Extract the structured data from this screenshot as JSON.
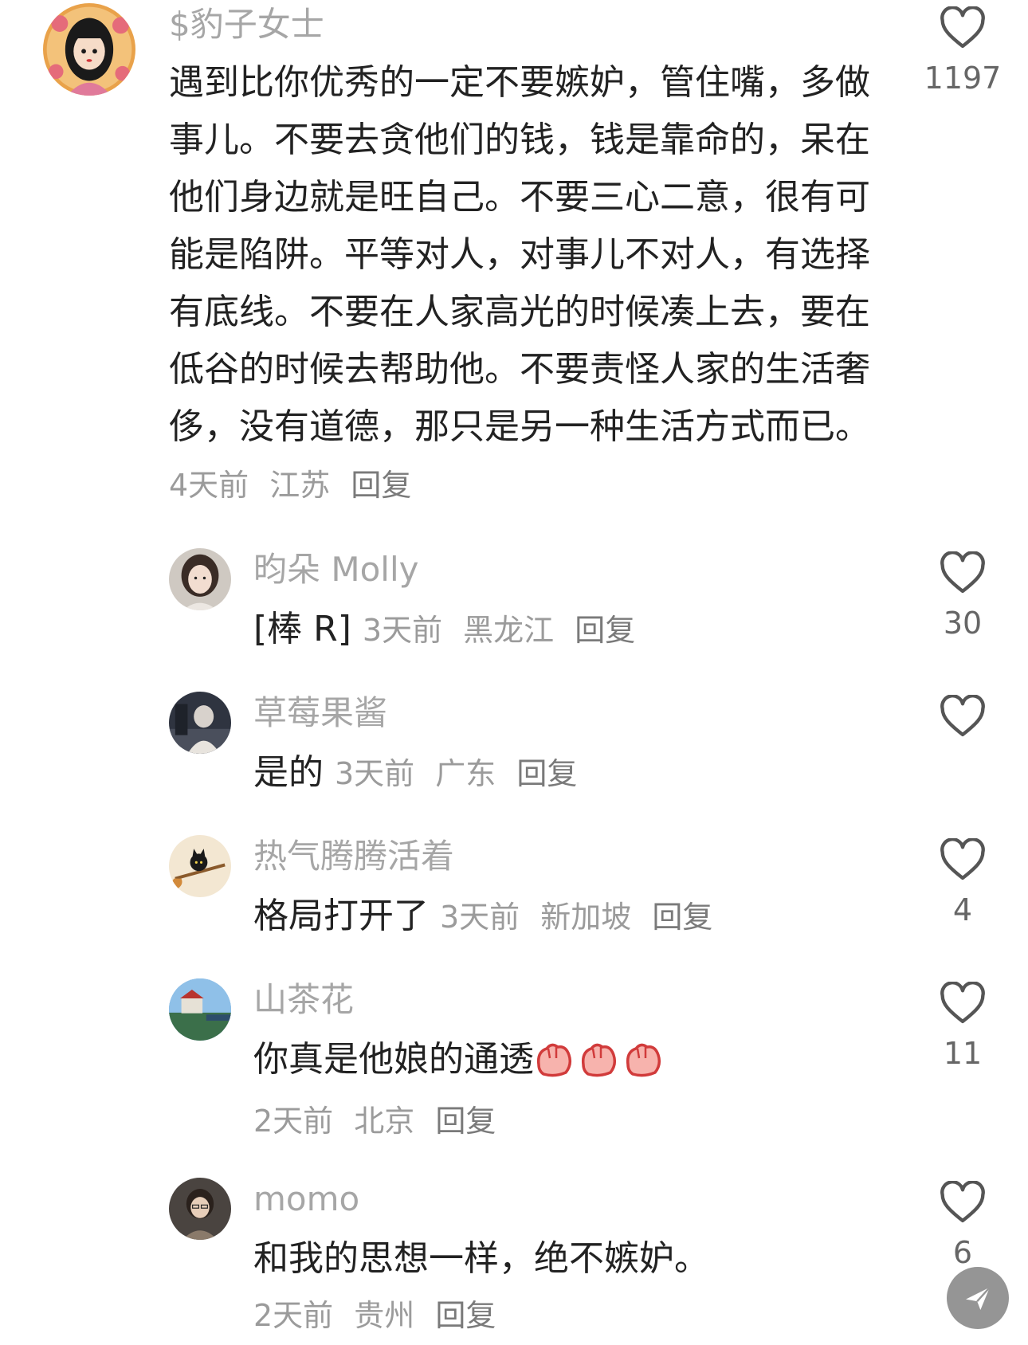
{
  "comments": [
    {
      "username": "$豹子女士",
      "content": "遇到比你优秀的一定不要嫉妒，管住嘴，多做事儿。不要去贪他们的钱，钱是靠命的，呆在他们身边就是旺自己。不要三心二意，很有可能是陷阱。平等对人，对事儿不对人，有选择有底线。不要在人家高光的时候凑上去，要在低谷的时候去帮助他。不要责怪人家的生活奢侈，没有道德，那只是另一种生活方式而已。",
      "time": "4天前",
      "location": "江苏",
      "reply_label": "回复",
      "likes": "1197"
    },
    {
      "username": "昀朵 Molly",
      "content": "[棒 R]",
      "time": "3天前",
      "location": "黑龙江",
      "reply_label": "回复",
      "likes": "30"
    },
    {
      "username": "草莓果酱",
      "content": "是的",
      "time": "3天前",
      "location": "广东",
      "reply_label": "回复",
      "likes": ""
    },
    {
      "username": "热气腾腾活着",
      "content": "格局打开了",
      "time": "3天前",
      "location": "新加坡",
      "reply_label": "回复",
      "likes": "4"
    },
    {
      "username": "山茶花",
      "content": "你真是他娘的通透",
      "time": "2天前",
      "location": "北京",
      "reply_label": "回复",
      "likes": "11"
    },
    {
      "username": "momo",
      "content": "和我的思想一样，绝不嫉妒。",
      "time": "2天前",
      "location": "贵州",
      "reply_label": "回复",
      "likes": "6"
    }
  ],
  "icons": {
    "like": "heart-outline-icon",
    "emoji": "fist-emoji-icon",
    "share": "paper-plane-icon"
  },
  "colors": {
    "username": "#a6a6a6",
    "text": "#222222",
    "meta": "#9b9b9b",
    "icon": "#555555"
  }
}
